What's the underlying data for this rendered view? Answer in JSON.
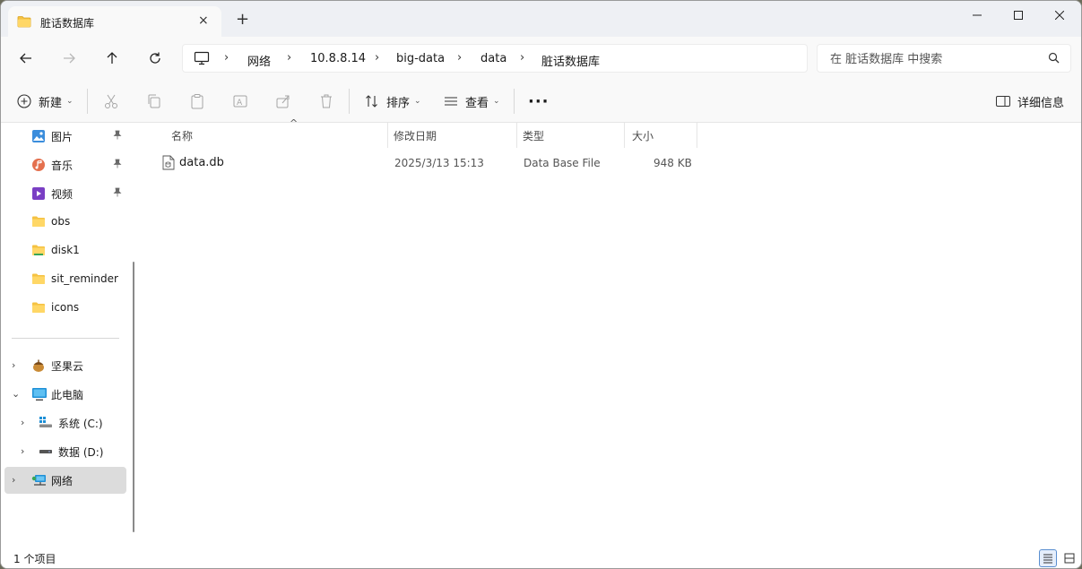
{
  "window": {
    "tab_title": "脏话数据库",
    "new_tab_label": "+",
    "close_tab_label": "×"
  },
  "address": {
    "segments": [
      "网络",
      "10.8.8.14",
      "big-data",
      "data",
      "脏话数据库"
    ]
  },
  "search": {
    "placeholder": "在 脏话数据库 中搜索"
  },
  "toolbar": {
    "new_label": "新建",
    "sort_label": "排序",
    "view_label": "查看",
    "more_label": "···",
    "details_label": "详细信息"
  },
  "sidebar": {
    "quick_access": [
      {
        "label": "图片",
        "icon": "pictures-icon",
        "pinned": true
      },
      {
        "label": "音乐",
        "icon": "music-icon",
        "pinned": true
      },
      {
        "label": "视频",
        "icon": "videos-icon",
        "pinned": true
      },
      {
        "label": "obs",
        "icon": "folder-icon",
        "pinned": false
      },
      {
        "label": "disk1",
        "icon": "folder-icon",
        "pinned": false
      },
      {
        "label": "sit_reminder",
        "icon": "folder-icon",
        "pinned": false
      },
      {
        "label": "icons",
        "icon": "folder-icon",
        "pinned": false
      }
    ],
    "tree": [
      {
        "label": "坚果云",
        "icon": "nutstore-icon",
        "expander": "›",
        "selected": false
      },
      {
        "label": "此电脑",
        "icon": "this-pc-icon",
        "expander": "⌄",
        "selected": false
      },
      {
        "label": "系统 (C:)",
        "icon": "system-drive-icon",
        "expander": "›",
        "selected": false
      },
      {
        "label": "数据 (D:)",
        "icon": "drive-icon",
        "expander": "›",
        "selected": false
      },
      {
        "label": "网络",
        "icon": "network-icon",
        "expander": "›",
        "selected": true
      }
    ]
  },
  "columns": {
    "name": "名称",
    "modified": "修改日期",
    "type": "类型",
    "size": "大小"
  },
  "files": [
    {
      "name": "data.db",
      "modified": "2025/3/13 15:13",
      "type": "Data Base File",
      "size": "948 KB"
    }
  ],
  "status": {
    "count": "1 个项目"
  },
  "colors": {
    "accent": "#0067c0",
    "folder": "#f5c242",
    "selected_nav": "#dcdcdc"
  }
}
